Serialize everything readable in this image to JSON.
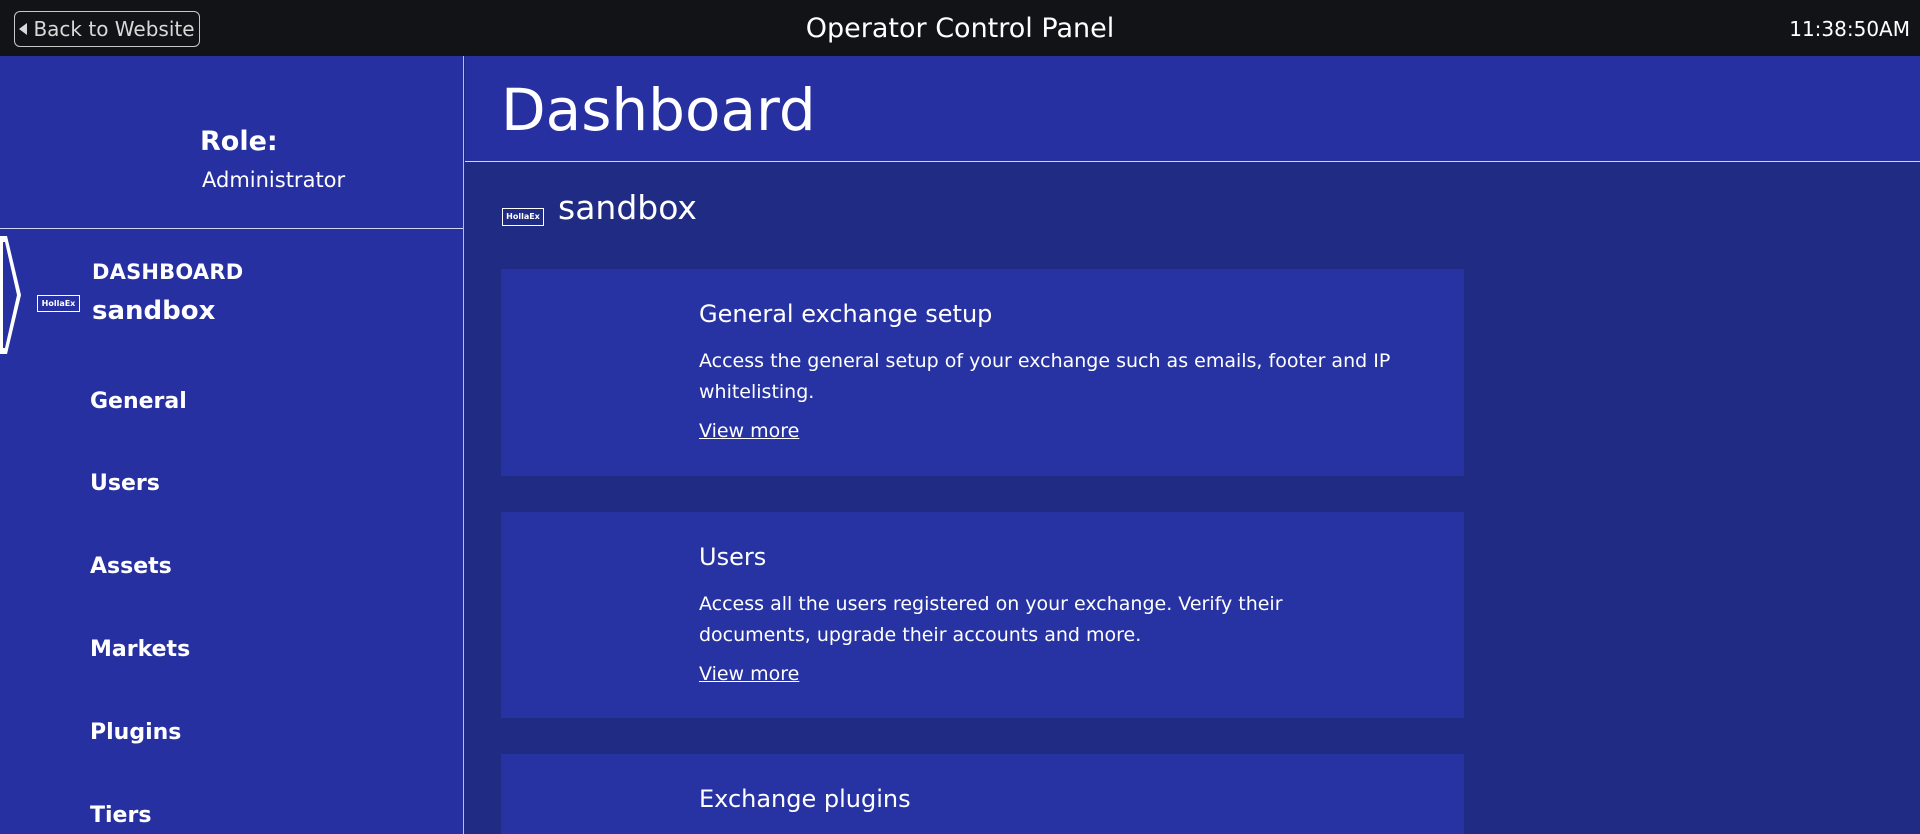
{
  "topbar": {
    "back_label": "Back to Website",
    "title": "Operator Control Panel",
    "clock": "11:38:50AM"
  },
  "sidebar": {
    "role_label": "Role:",
    "role_value": "Administrator",
    "active": {
      "title": "DASHBOARD",
      "subtitle": "sandbox",
      "logo_text": "HollaEx"
    },
    "items": [
      {
        "label": "General"
      },
      {
        "label": "Users"
      },
      {
        "label": "Assets"
      },
      {
        "label": "Markets"
      },
      {
        "label": "Plugins"
      },
      {
        "label": "Tiers"
      }
    ]
  },
  "main": {
    "page_title": "Dashboard",
    "exchange_name": "sandbox",
    "exchange_logo_text": "HollaEx",
    "cards": [
      {
        "title": "General exchange setup",
        "description": "Access the general setup of your exchange such as emails, footer and IP whitelisting.",
        "link": "View more"
      },
      {
        "title": "Users",
        "description": "Access all the users registered on your exchange. Verify their documents, upgrade their accounts and more.",
        "link": "View more"
      },
      {
        "title": "Exchange plugins",
        "description": "",
        "link": ""
      }
    ]
  },
  "colors": {
    "topbar_bg": "#121317",
    "sidebar_bg": "#2630a0",
    "content_bg": "#202c84",
    "card_bg": "#2733a2",
    "text": "#ffffff"
  }
}
